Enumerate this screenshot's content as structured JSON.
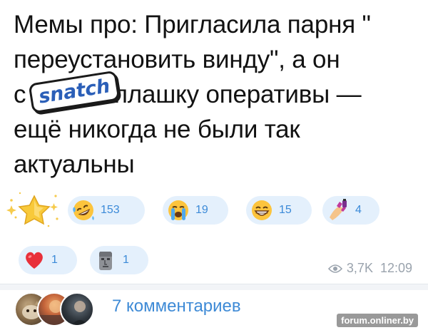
{
  "post": {
    "line1": "Мемы про: Пригласила парня \"",
    "line2": "переустановить винду\", а он",
    "line3_start": "с",
    "line3_sticker": "snatch",
    "line3_end": "л плашку оперативы —",
    "line4": "ещё никогда не были так",
    "line5": "актуальны"
  },
  "reactions": [
    {
      "icon": "star-sparkle-icon",
      "count": ""
    },
    {
      "icon": "rolling-laughing-face-icon",
      "count": "153"
    },
    {
      "icon": "loudly-crying-face-icon",
      "count": "19"
    },
    {
      "icon": "grinning-face-icon",
      "count": "15"
    },
    {
      "icon": "nail-polish-icon",
      "count": "4"
    },
    {
      "icon": "red-heart-icon",
      "count": "1"
    },
    {
      "icon": "moai-icon",
      "count": "1"
    }
  ],
  "meta": {
    "views": "3,7K",
    "time": "12:09"
  },
  "comments": {
    "label": "7 комментариев"
  },
  "watermark": "forum.onliner.by"
}
